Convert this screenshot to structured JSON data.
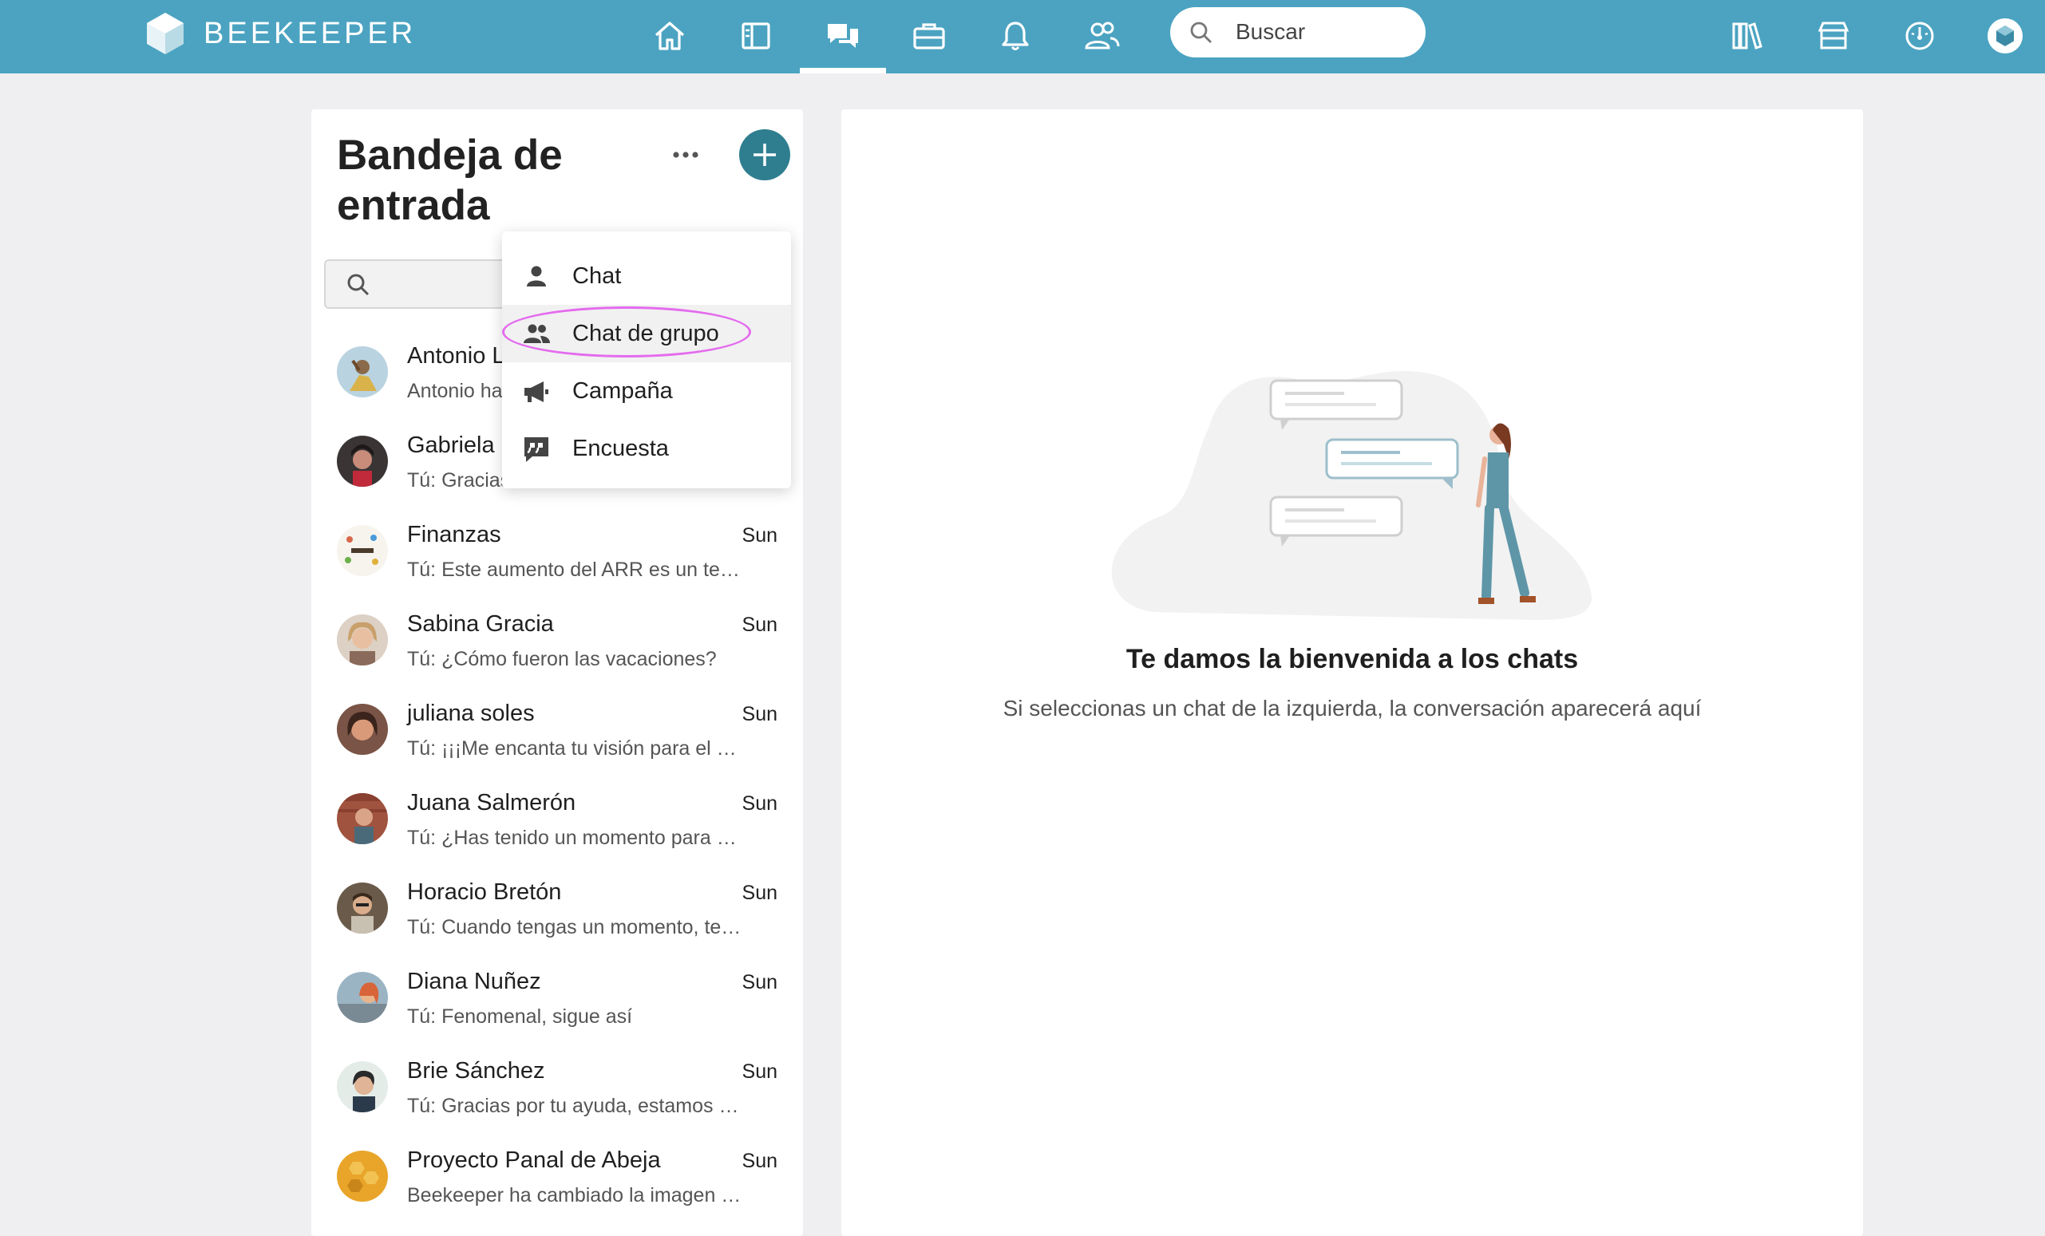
{
  "app": {
    "brand": "BEEKEEPER"
  },
  "topbar": {
    "nav": [
      {
        "name": "home-icon"
      },
      {
        "name": "streams-icon"
      },
      {
        "name": "chats-icon",
        "active": true
      },
      {
        "name": "tools-icon"
      },
      {
        "name": "notifications-icon"
      },
      {
        "name": "people-icon"
      }
    ],
    "search_placeholder": "Buscar",
    "right_icons": [
      "library-icon",
      "store-icon",
      "dashboard-icon",
      "profile-icon"
    ],
    "bar_color": "#4ba3c1"
  },
  "inbox": {
    "title": "Bandeja de entrada",
    "add_button_color": "#2f7e90",
    "chats": [
      {
        "name": "Antonio L",
        "time": "",
        "message": "Antonio ha"
      },
      {
        "name": "Gabriela S",
        "time": "",
        "message": "Tú: Gracias"
      },
      {
        "name": "Finanzas",
        "time": "Sun",
        "message": "Tú: Este aumento del ARR es un testi…"
      },
      {
        "name": "Sabina Gracia",
        "time": "Sun",
        "message": "Tú: ¿Cómo fueron las vacaciones?"
      },
      {
        "name": "juliana soles",
        "time": "Sun",
        "message": "Tú: ¡¡¡Me encanta tu visión para el pr…"
      },
      {
        "name": "Juana Salmerón",
        "time": "Sun",
        "message": "Tú: ¿Has tenido un momento para …"
      },
      {
        "name": "Horacio Bretón",
        "time": "Sun",
        "message": "Tú: Cuando tengas un momento, te…"
      },
      {
        "name": "Diana Nuñez",
        "time": "Sun",
        "message": "Tú: Fenomenal, sigue así"
      },
      {
        "name": "Brie Sánchez",
        "time": "Sun",
        "message": "Tú: Gracias por tu ayuda, estamos e…"
      },
      {
        "name": "Proyecto Panal de Abeja",
        "time": "Sun",
        "message": "Beekeeper ha cambiado la imagen …"
      }
    ]
  },
  "dropdown": {
    "items": [
      {
        "label": "Chat",
        "icon": "person-icon"
      },
      {
        "label": "Chat de grupo",
        "icon": "group-icon",
        "highlighted": true
      },
      {
        "label": "Campaña",
        "icon": "megaphone-icon"
      },
      {
        "label": "Encuesta",
        "icon": "quote-icon"
      }
    ]
  },
  "welcome": {
    "title": "Te damos la bienvenida a los chats",
    "subtitle": "Si seleccionas un chat de la izquierda, la conversación aparecerá aquí"
  }
}
